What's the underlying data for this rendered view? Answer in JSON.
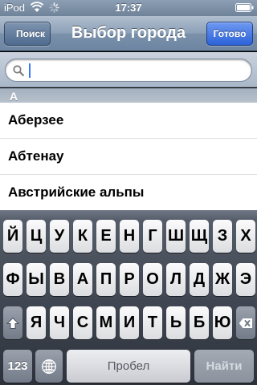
{
  "status_bar": {
    "carrier": "iPod",
    "time": "17:37",
    "icons": [
      "wifi-icon",
      "activity-spinner-icon",
      "battery-icon"
    ]
  },
  "nav": {
    "back_label": "Поиск",
    "title": "Выбор города",
    "done_label": "Готово"
  },
  "search": {
    "value": "",
    "placeholder": "",
    "icon": "search-icon"
  },
  "list": {
    "section_header": "А",
    "items": [
      "Аберзее",
      "Абтенау",
      "Австрийские альпы"
    ]
  },
  "keyboard": {
    "row1": [
      "Й",
      "Ц",
      "У",
      "К",
      "Е",
      "Н",
      "Г",
      "Ш",
      "Щ",
      "З",
      "Х"
    ],
    "row2": [
      "Ф",
      "Ы",
      "В",
      "А",
      "П",
      "Р",
      "О",
      "Л",
      "Д",
      "Ж",
      "Э"
    ],
    "row3": [
      "Я",
      "Ч",
      "С",
      "М",
      "И",
      "Т",
      "Ь",
      "Б",
      "Ю"
    ],
    "numbers_label": "123",
    "space_label": "Пробел",
    "go_label": "Найти",
    "shift_icon": "shift-icon",
    "globe_icon": "globe-icon",
    "delete_icon": "backspace-icon"
  },
  "colors": {
    "nav_bar": "#8ca0b7",
    "done_button": "#2b62d9",
    "keyboard_bg": "#2c313a"
  }
}
